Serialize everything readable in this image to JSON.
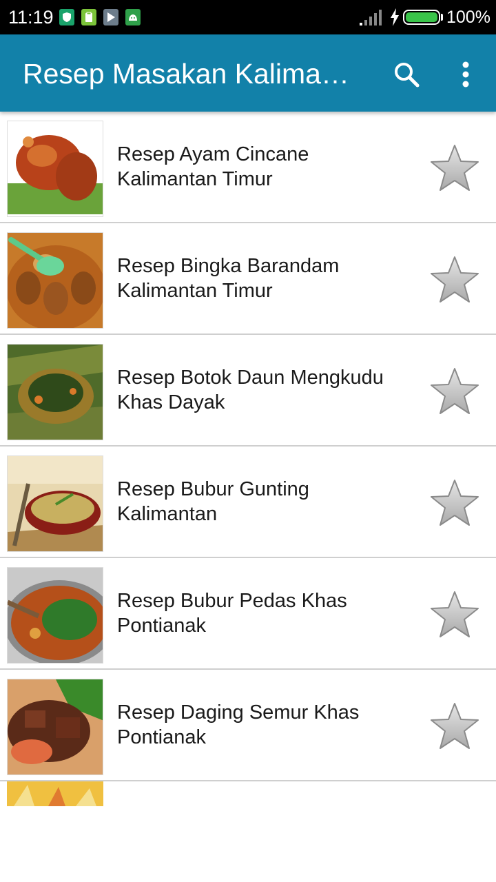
{
  "status_bar": {
    "time": "11:19",
    "battery_percent": "100%",
    "battery_level": 1.0
  },
  "app_bar": {
    "title": "Resep Masakan Kalima…",
    "search_icon": "search-icon",
    "menu_icon": "more-vert-icon"
  },
  "recipes": [
    {
      "title": "Resep Ayam Cincane Kalimantan Timur",
      "favorite": false
    },
    {
      "title": "Resep Bingka Barandam Kalimantan Timur",
      "favorite": false
    },
    {
      "title": "Resep Botok Daun Mengkudu Khas Dayak",
      "favorite": false
    },
    {
      "title": "Resep Bubur Gunting Kalimantan",
      "favorite": false
    },
    {
      "title": "Resep Bubur Pedas Khas Pontianak",
      "favorite": false
    },
    {
      "title": "Resep Daging Semur Khas Pontianak",
      "favorite": false
    }
  ],
  "colors": {
    "app_bar": "#1281a9",
    "status_bar": "#000000",
    "divider": "#cfcfcf",
    "star": "#c8c8c8"
  }
}
